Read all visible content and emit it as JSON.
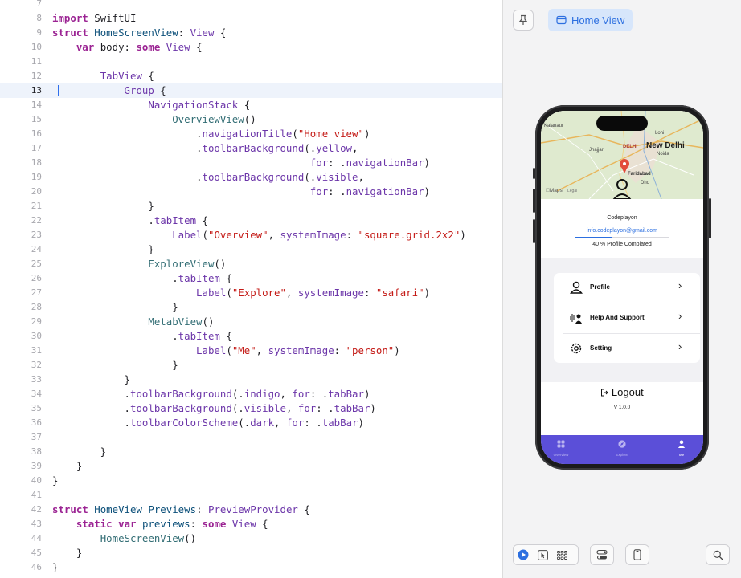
{
  "editor": {
    "current_line": 13,
    "lines": [
      {
        "n": "7",
        "tokens": []
      },
      {
        "n": "8",
        "tokens": [
          {
            "t": "import",
            "c": "kw"
          },
          {
            "t": " SwiftUI",
            "c": ""
          }
        ]
      },
      {
        "n": "9",
        "tokens": [
          {
            "t": "struct",
            "c": "kw"
          },
          {
            "t": " ",
            "c": ""
          },
          {
            "t": "HomeScreenView",
            "c": "ty"
          },
          {
            "t": ": ",
            "c": ""
          },
          {
            "t": "View",
            "c": "pm"
          },
          {
            "t": " {",
            "c": ""
          }
        ]
      },
      {
        "n": "10",
        "tokens": [
          {
            "t": "    ",
            "c": ""
          },
          {
            "t": "var",
            "c": "kw"
          },
          {
            "t": " body: ",
            "c": ""
          },
          {
            "t": "some",
            "c": "kw"
          },
          {
            "t": " ",
            "c": ""
          },
          {
            "t": "View",
            "c": "pm"
          },
          {
            "t": " {",
            "c": ""
          }
        ]
      },
      {
        "n": "11",
        "tokens": []
      },
      {
        "n": "12",
        "tokens": [
          {
            "t": "        ",
            "c": ""
          },
          {
            "t": "TabView",
            "c": "pm"
          },
          {
            "t": " {",
            "c": ""
          }
        ]
      },
      {
        "n": "13",
        "tokens": [
          {
            "t": "            ",
            "c": ""
          },
          {
            "t": "Group",
            "c": "pm"
          },
          {
            "t": " {",
            "c": ""
          }
        ]
      },
      {
        "n": "14",
        "tokens": [
          {
            "t": "                ",
            "c": ""
          },
          {
            "t": "NavigationStack",
            "c": "pm"
          },
          {
            "t": " {",
            "c": ""
          }
        ]
      },
      {
        "n": "15",
        "tokens": [
          {
            "t": "                    ",
            "c": ""
          },
          {
            "t": "OverviewView",
            "c": "fn"
          },
          {
            "t": "()",
            "c": ""
          }
        ]
      },
      {
        "n": "16",
        "tokens": [
          {
            "t": "                        .",
            "c": ""
          },
          {
            "t": "navigationTitle",
            "c": "pm"
          },
          {
            "t": "(",
            "c": ""
          },
          {
            "t": "\"Home view\"",
            "c": "st"
          },
          {
            "t": ")",
            "c": ""
          }
        ]
      },
      {
        "n": "17",
        "tokens": [
          {
            "t": "                        .",
            "c": ""
          },
          {
            "t": "toolbarBackground",
            "c": "pm"
          },
          {
            "t": "(.",
            "c": ""
          },
          {
            "t": "yellow",
            "c": "pm"
          },
          {
            "t": ",",
            "c": ""
          }
        ]
      },
      {
        "n": "18",
        "tokens": [
          {
            "t": "                                           ",
            "c": ""
          },
          {
            "t": "for",
            "c": "pm"
          },
          {
            "t": ": .",
            "c": ""
          },
          {
            "t": "navigationBar",
            "c": "pm"
          },
          {
            "t": ")",
            "c": ""
          }
        ]
      },
      {
        "n": "19",
        "tokens": [
          {
            "t": "                        .",
            "c": ""
          },
          {
            "t": "toolbarBackground",
            "c": "pm"
          },
          {
            "t": "(.",
            "c": ""
          },
          {
            "t": "visible",
            "c": "pm"
          },
          {
            "t": ",",
            "c": ""
          }
        ]
      },
      {
        "n": "20",
        "tokens": [
          {
            "t": "                                           ",
            "c": ""
          },
          {
            "t": "for",
            "c": "pm"
          },
          {
            "t": ": .",
            "c": ""
          },
          {
            "t": "navigationBar",
            "c": "pm"
          },
          {
            "t": ")",
            "c": ""
          }
        ]
      },
      {
        "n": "21",
        "tokens": [
          {
            "t": "                }",
            "c": ""
          }
        ]
      },
      {
        "n": "22",
        "tokens": [
          {
            "t": "                .",
            "c": ""
          },
          {
            "t": "tabItem",
            "c": "pm"
          },
          {
            "t": " {",
            "c": ""
          }
        ]
      },
      {
        "n": "23",
        "tokens": [
          {
            "t": "                    ",
            "c": ""
          },
          {
            "t": "Label",
            "c": "pm"
          },
          {
            "t": "(",
            "c": ""
          },
          {
            "t": "\"Overview\"",
            "c": "st"
          },
          {
            "t": ", ",
            "c": ""
          },
          {
            "t": "systemImage",
            "c": "pm"
          },
          {
            "t": ": ",
            "c": ""
          },
          {
            "t": "\"square.grid.2x2\"",
            "c": "st"
          },
          {
            "t": ")",
            "c": ""
          }
        ]
      },
      {
        "n": "24",
        "tokens": [
          {
            "t": "                }",
            "c": ""
          }
        ]
      },
      {
        "n": "25",
        "tokens": [
          {
            "t": "                ",
            "c": ""
          },
          {
            "t": "ExploreView",
            "c": "fn"
          },
          {
            "t": "()",
            "c": ""
          }
        ]
      },
      {
        "n": "26",
        "tokens": [
          {
            "t": "                    .",
            "c": ""
          },
          {
            "t": "tabItem",
            "c": "pm"
          },
          {
            "t": " {",
            "c": ""
          }
        ]
      },
      {
        "n": "27",
        "tokens": [
          {
            "t": "                        ",
            "c": ""
          },
          {
            "t": "Label",
            "c": "pm"
          },
          {
            "t": "(",
            "c": ""
          },
          {
            "t": "\"Explore\"",
            "c": "st"
          },
          {
            "t": ", ",
            "c": ""
          },
          {
            "t": "systemImage",
            "c": "pm"
          },
          {
            "t": ": ",
            "c": ""
          },
          {
            "t": "\"safari\"",
            "c": "st"
          },
          {
            "t": ")",
            "c": ""
          }
        ]
      },
      {
        "n": "28",
        "tokens": [
          {
            "t": "                    }",
            "c": ""
          }
        ]
      },
      {
        "n": "29",
        "tokens": [
          {
            "t": "                ",
            "c": ""
          },
          {
            "t": "MetabView",
            "c": "fn"
          },
          {
            "t": "()",
            "c": ""
          }
        ]
      },
      {
        "n": "30",
        "tokens": [
          {
            "t": "                    .",
            "c": ""
          },
          {
            "t": "tabItem",
            "c": "pm"
          },
          {
            "t": " {",
            "c": ""
          }
        ]
      },
      {
        "n": "31",
        "tokens": [
          {
            "t": "                        ",
            "c": ""
          },
          {
            "t": "Label",
            "c": "pm"
          },
          {
            "t": "(",
            "c": ""
          },
          {
            "t": "\"Me\"",
            "c": "st"
          },
          {
            "t": ", ",
            "c": ""
          },
          {
            "t": "systemImage",
            "c": "pm"
          },
          {
            "t": ": ",
            "c": ""
          },
          {
            "t": "\"person\"",
            "c": "st"
          },
          {
            "t": ")",
            "c": ""
          }
        ]
      },
      {
        "n": "32",
        "tokens": [
          {
            "t": "                    }",
            "c": ""
          }
        ]
      },
      {
        "n": "33",
        "tokens": [
          {
            "t": "            }",
            "c": ""
          }
        ]
      },
      {
        "n": "34",
        "tokens": [
          {
            "t": "            .",
            "c": ""
          },
          {
            "t": "toolbarBackground",
            "c": "pm"
          },
          {
            "t": "(.",
            "c": ""
          },
          {
            "t": "indigo",
            "c": "pm"
          },
          {
            "t": ", ",
            "c": ""
          },
          {
            "t": "for",
            "c": "pm"
          },
          {
            "t": ": .",
            "c": ""
          },
          {
            "t": "tabBar",
            "c": "pm"
          },
          {
            "t": ")",
            "c": ""
          }
        ]
      },
      {
        "n": "35",
        "tokens": [
          {
            "t": "            .",
            "c": ""
          },
          {
            "t": "toolbarBackground",
            "c": "pm"
          },
          {
            "t": "(.",
            "c": ""
          },
          {
            "t": "visible",
            "c": "pm"
          },
          {
            "t": ", ",
            "c": ""
          },
          {
            "t": "for",
            "c": "pm"
          },
          {
            "t": ": .",
            "c": ""
          },
          {
            "t": "tabBar",
            "c": "pm"
          },
          {
            "t": ")",
            "c": ""
          }
        ]
      },
      {
        "n": "36",
        "tokens": [
          {
            "t": "            .",
            "c": ""
          },
          {
            "t": "toolbarColorScheme",
            "c": "pm"
          },
          {
            "t": "(.",
            "c": ""
          },
          {
            "t": "dark",
            "c": "pm"
          },
          {
            "t": ", ",
            "c": ""
          },
          {
            "t": "for",
            "c": "pm"
          },
          {
            "t": ": .",
            "c": ""
          },
          {
            "t": "tabBar",
            "c": "pm"
          },
          {
            "t": ")",
            "c": ""
          }
        ]
      },
      {
        "n": "37",
        "tokens": []
      },
      {
        "n": "38",
        "tokens": [
          {
            "t": "        }",
            "c": ""
          }
        ]
      },
      {
        "n": "39",
        "tokens": [
          {
            "t": "    }",
            "c": ""
          }
        ]
      },
      {
        "n": "40",
        "tokens": [
          {
            "t": "}",
            "c": ""
          }
        ]
      },
      {
        "n": "41",
        "tokens": []
      },
      {
        "n": "42",
        "tokens": [
          {
            "t": "struct",
            "c": "kw"
          },
          {
            "t": " ",
            "c": ""
          },
          {
            "t": "HomeView_Previews",
            "c": "ty"
          },
          {
            "t": ": ",
            "c": ""
          },
          {
            "t": "PreviewProvider",
            "c": "pm"
          },
          {
            "t": " {",
            "c": ""
          }
        ]
      },
      {
        "n": "43",
        "tokens": [
          {
            "t": "    ",
            "c": ""
          },
          {
            "t": "static",
            "c": "kw"
          },
          {
            "t": " ",
            "c": ""
          },
          {
            "t": "var",
            "c": "kw"
          },
          {
            "t": " ",
            "c": ""
          },
          {
            "t": "previews",
            "c": "ty"
          },
          {
            "t": ": ",
            "c": ""
          },
          {
            "t": "some",
            "c": "kw"
          },
          {
            "t": " ",
            "c": ""
          },
          {
            "t": "View",
            "c": "pm"
          },
          {
            "t": " {",
            "c": ""
          }
        ]
      },
      {
        "n": "44",
        "tokens": [
          {
            "t": "        ",
            "c": ""
          },
          {
            "t": "HomeScreenView",
            "c": "fn"
          },
          {
            "t": "()",
            "c": ""
          }
        ]
      },
      {
        "n": "45",
        "tokens": [
          {
            "t": "    }",
            "c": ""
          }
        ]
      },
      {
        "n": "46",
        "tokens": [
          {
            "t": "}",
            "c": ""
          }
        ]
      },
      {
        "n": "47",
        "tokens": []
      }
    ]
  },
  "canvas": {
    "pin_icon": "pin-icon",
    "preview_chip": {
      "label": "Home View",
      "icon": "preview-window-icon"
    },
    "toolbar": {
      "buttons": [
        "live-preview-play-icon",
        "selectable-cursor-icon",
        "variants-grid-icon",
        "device-settings-icon",
        "device-frame-icon",
        "zoom-search-icon"
      ]
    }
  },
  "phone": {
    "map": {
      "maps_label": "Maps",
      "legal_label": "Legal",
      "city": "New Delhi",
      "labels": [
        "Kalanaur",
        "Jhajjar",
        "DELHI",
        "Noida",
        "Faridabad",
        "Loni",
        "Dho",
        "Loni"
      ]
    },
    "profile": {
      "name": "Codeplayon",
      "email": "info.codeplayon@gmail.com",
      "progress_fraction": 0.4,
      "progress_text": "40 % Profile Complated"
    },
    "menu": [
      {
        "label": "Profile",
        "icon": "person-icon"
      },
      {
        "label": "Help And Support",
        "icon": "support-person-icon"
      },
      {
        "label": "Setting",
        "icon": "gear-icon"
      }
    ],
    "logout": {
      "label": "Logout",
      "icon": "logout-icon"
    },
    "version": "V 1.0.0",
    "tabs": [
      {
        "label": "Overview",
        "icon": "square-grid-icon",
        "active": false
      },
      {
        "label": "Explore",
        "icon": "safari-compass-icon",
        "active": false
      },
      {
        "label": "Me",
        "icon": "person-fill-icon",
        "active": true
      }
    ],
    "colors": {
      "tabbar": "#5b4fd8",
      "accent": "#2c6fe0"
    }
  }
}
